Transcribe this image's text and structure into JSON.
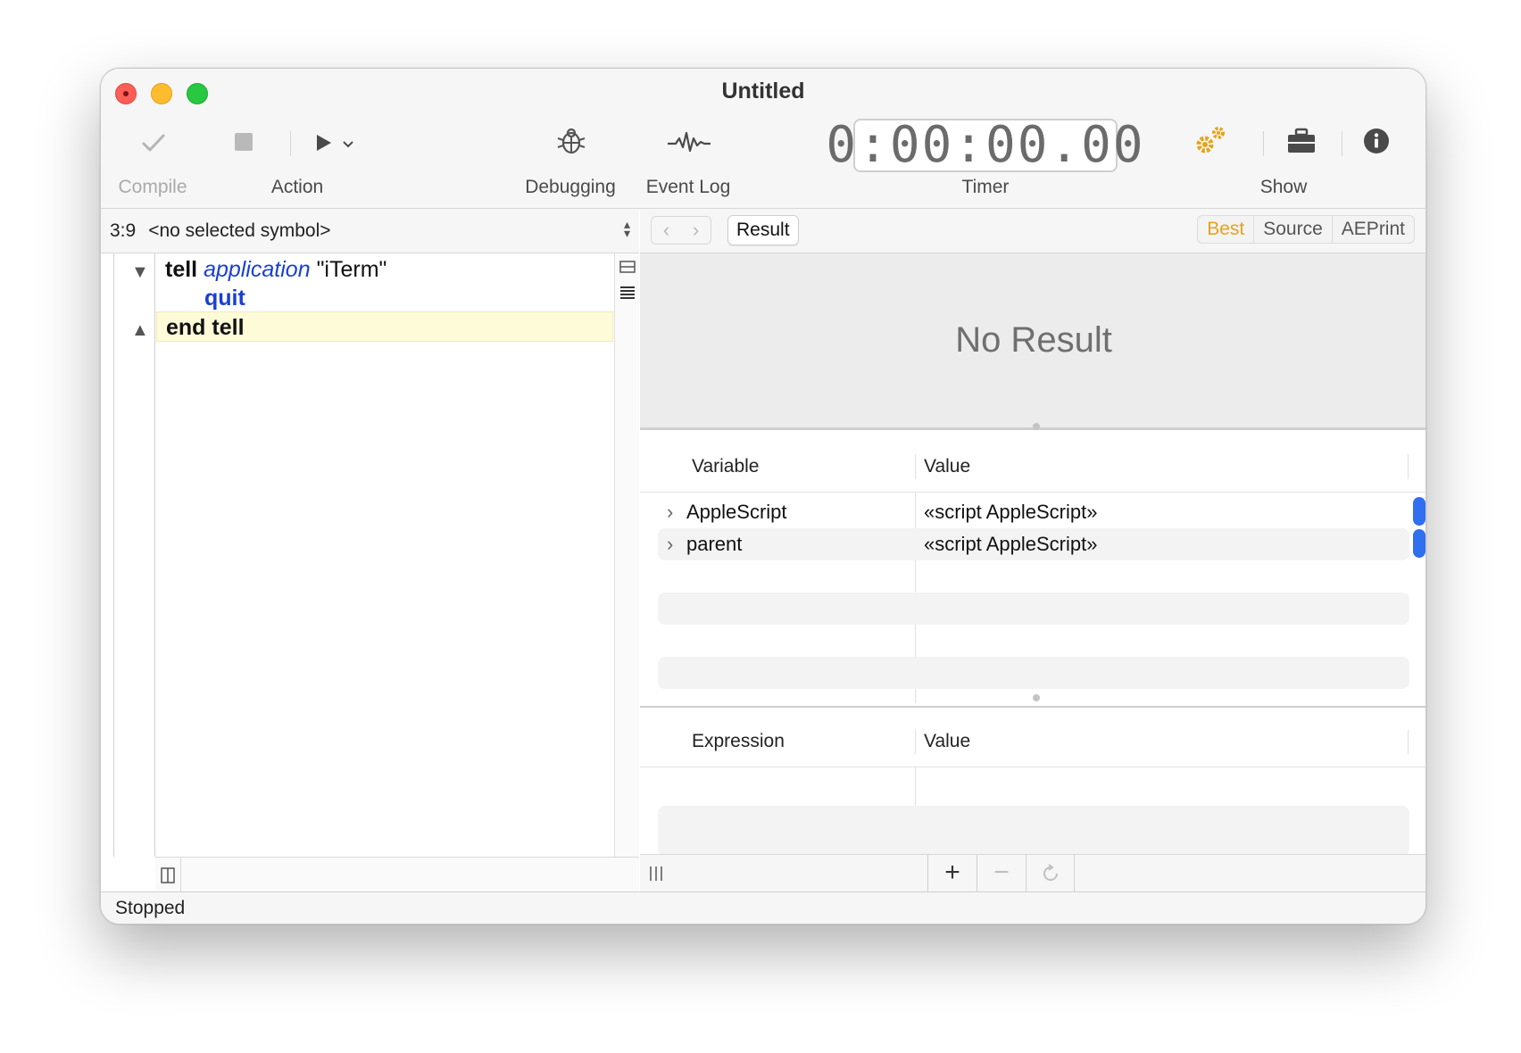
{
  "window": {
    "title": "Untitled"
  },
  "toolbar": {
    "compile_label": "Compile",
    "action_label": "Action",
    "debugging_label": "Debugging",
    "event_log_label": "Event Log",
    "timer_label": "Timer",
    "timer_value": "0:00:00.00",
    "show_label": "Show",
    "accent_color": "#e8a21b"
  },
  "navigator": {
    "position": "3:9",
    "symbol": "<no selected symbol>"
  },
  "code": {
    "line1": {
      "kw": "tell",
      "cls": "application",
      "str": "\"iTerm\""
    },
    "line2": {
      "cmd": "quit"
    },
    "line3": {
      "kw": "end tell"
    }
  },
  "result_bar": {
    "result_button": "Result",
    "modes": [
      "Best",
      "Source",
      "AEPrint"
    ],
    "active_mode": "Best"
  },
  "result": {
    "text": "No Result"
  },
  "variables": {
    "headers": {
      "name": "Variable",
      "value": "Value"
    },
    "rows": [
      {
        "name": "AppleScript",
        "value": "«script AppleScript»"
      },
      {
        "name": "parent",
        "value": "«script AppleScript»"
      }
    ]
  },
  "expressions": {
    "headers": {
      "name": "Expression",
      "value": "Value"
    }
  },
  "status": {
    "text": "Stopped"
  }
}
